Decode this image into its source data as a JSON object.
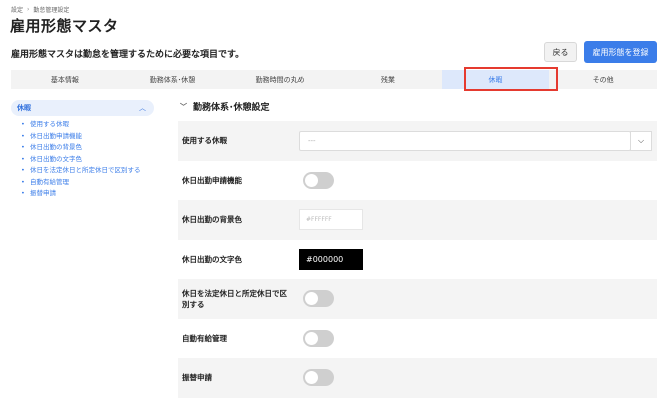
{
  "breadcrumb": {
    "items": [
      "設定",
      "勤怠管理設定"
    ],
    "separator": "›"
  },
  "page": {
    "title": "雇用形態マスタ",
    "description": "雇用形態マスタは勤怠を管理するために必要な項目です。"
  },
  "actions": {
    "back_label": "戻る",
    "register_label": "雇用形態を登録"
  },
  "tabs": [
    {
      "label": "基本情報"
    },
    {
      "label": "勤務体系･休憩"
    },
    {
      "label": "勤務時間の丸め"
    },
    {
      "label": "残業"
    },
    {
      "label": "休暇"
    },
    {
      "label": "その他"
    }
  ],
  "sidebar": {
    "group_label": "休暇",
    "items": [
      {
        "label": "使用する休暇"
      },
      {
        "label": "休日出勤申請機能"
      },
      {
        "label": "休日出勤の背景色"
      },
      {
        "label": "休日出勤の文字色"
      },
      {
        "label": "休日を法定休日と所定休日で区別する"
      },
      {
        "label": "自動有給管理"
      },
      {
        "label": "振替申請"
      }
    ]
  },
  "section": {
    "title": "勤務体系･休憩設定"
  },
  "fields": {
    "holiday_types": {
      "label": "使用する休暇",
      "value": "---"
    },
    "holiday_work_request": {
      "label": "休日出勤申請機能",
      "on": false
    },
    "holiday_bg_color": {
      "label": "休日出勤の背景色",
      "value": "#FFFFFF"
    },
    "holiday_text_color": {
      "label": "休日出勤の文字色",
      "value": "#000000"
    },
    "distinguish_holidays": {
      "label": "休日を法定休日と所定休日で区別する",
      "on": false
    },
    "auto_paid_leave": {
      "label": "自動有給管理",
      "on": false
    },
    "substitute_request": {
      "label": "振替申請",
      "on": false
    }
  },
  "colors": {
    "accent": "#3b7de9",
    "highlight": "#e53a2f"
  }
}
